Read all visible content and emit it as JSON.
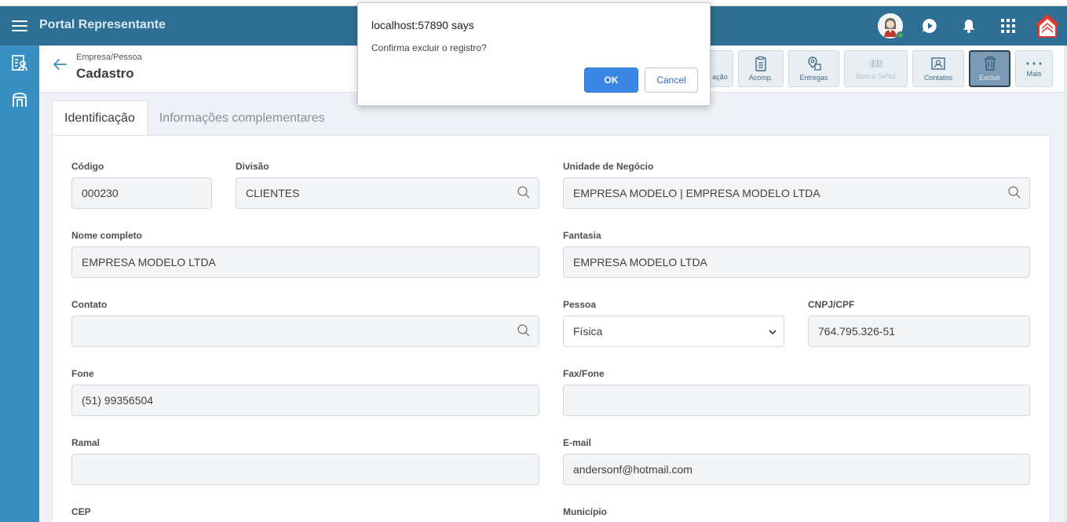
{
  "header": {
    "app_title": "Portal Representante"
  },
  "subheader": {
    "breadcrumb": "Empresa/Pessoa",
    "title": "Cadastro"
  },
  "toolbar": {
    "buttons": [
      {
        "label": "ação",
        "icon": "document-icon",
        "state": "normal"
      },
      {
        "label": "Acomp.",
        "icon": "clipboard-icon",
        "state": "normal"
      },
      {
        "label": "Entregas",
        "icon": "location-icon",
        "state": "normal"
      },
      {
        "label": "Busca Sefaz",
        "icon": "barcode-icon",
        "state": "disabled"
      },
      {
        "label": "Contatos",
        "icon": "contact-card-icon",
        "state": "normal"
      },
      {
        "label": "Excluir",
        "icon": "trash-icon",
        "state": "active"
      },
      {
        "label": "Mais",
        "icon": "more-icon",
        "state": "normal"
      }
    ]
  },
  "tabs": [
    {
      "label": "Identificação",
      "active": true
    },
    {
      "label": "Informações complementares",
      "active": false
    }
  ],
  "form": {
    "codigo": {
      "label": "Código",
      "value": "000230"
    },
    "divisao": {
      "label": "Divisão",
      "value": "CLIENTES"
    },
    "unidade": {
      "label": "Unidade de Negócio",
      "value": "EMPRESA MODELO | EMPRESA MODELO LTDA"
    },
    "nome": {
      "label": "Nome completo",
      "value": "EMPRESA MODELO LTDA"
    },
    "fantasia": {
      "label": "Fantasia",
      "value": "EMPRESA MODELO LTDA"
    },
    "contato": {
      "label": "Contato",
      "value": ""
    },
    "pessoa": {
      "label": "Pessoa",
      "value": "Física"
    },
    "cnpj": {
      "label": "CNPJ/CPF",
      "value": "764.795.326-51"
    },
    "fone": {
      "label": "Fone",
      "value": "(51) 99356504"
    },
    "fax": {
      "label": "Fax/Fone",
      "value": ""
    },
    "ramal": {
      "label": "Ramal",
      "value": ""
    },
    "email": {
      "label": "E-mail",
      "value": "andersonf@hotmail.com"
    },
    "cep": {
      "label": "CEP"
    },
    "municipio": {
      "label": "Município"
    }
  },
  "dialog": {
    "title": "localhost:57890 says",
    "message": "Confirma excluir o registro?",
    "ok_label": "OK",
    "cancel_label": "Cancel"
  },
  "colors": {
    "header": "#2f6f93",
    "sidebar": "#3a8fc2",
    "ok_button": "#3c86e6",
    "presence": "#3cb44b"
  }
}
